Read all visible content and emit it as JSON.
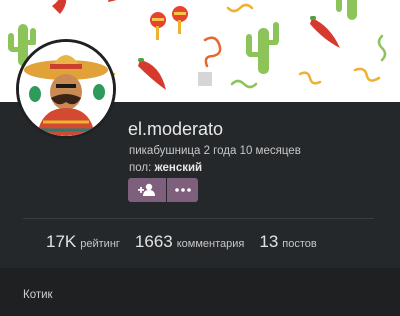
{
  "profile": {
    "username": "el.moderato",
    "tenure": "пикабушница 2 года 10 месяцев",
    "gender_label": "пол:",
    "gender_value": "женский",
    "about": "Котик"
  },
  "actions": {
    "subscribe_icon": "add-user-icon",
    "more_icon": "more-icon"
  },
  "stats": [
    {
      "value": "17K",
      "label": "рейтинг"
    },
    {
      "value": "1663",
      "label": "комментария"
    },
    {
      "value": "13",
      "label": "постов"
    }
  ],
  "colors": {
    "accent": "#7e5f7c",
    "background": "#25282b"
  }
}
